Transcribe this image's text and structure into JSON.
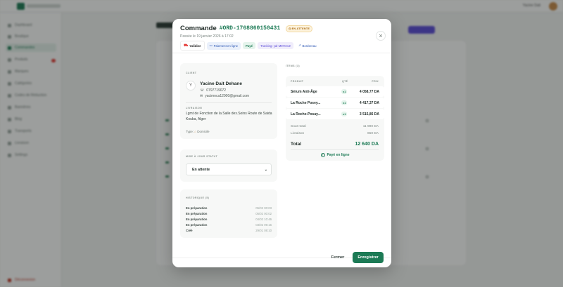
{
  "modal": {
    "title": "Commande",
    "order_number": "#ORD-1768860150431",
    "status_badge": "EN ATTENTE",
    "subtitle": "Passée le 19 janvier 2026 à 17:02",
    "close_symbol": "×"
  },
  "chips": {
    "carrier": "Yalidine",
    "payment": "Paiement en ligne",
    "paid": "Payé",
    "tracking": "Tracking: yal-M97CCZ",
    "bordereau": "Bordereau"
  },
  "client": {
    "section_label": "CLIENT",
    "initial": "Y",
    "name": "Yacine Dait Dehane",
    "phone": "0797719072",
    "email": "yacimnca12000@gmail.com",
    "address_label": "LIVRAISON",
    "address": "Lgmt de Fonction de la Salle dex.Soins Route de Saida",
    "city": "Kouba, Alger",
    "type_label": "Type:",
    "type_value": "Domicile"
  },
  "status": {
    "section_label": "MISE À JOUR STATUT",
    "selected": "En attente"
  },
  "history": {
    "section_label": "HISTORIQUE (5)",
    "rows": [
      {
        "status": "En préparation",
        "date": "05/02 00:03"
      },
      {
        "status": "En préparation",
        "date": "05/02 00:02"
      },
      {
        "status": "En préparation",
        "date": "04/02 10:46"
      },
      {
        "status": "En préparation",
        "date": "03/02 09:16"
      },
      {
        "status": "Créé",
        "date": "29/01 08:10"
      }
    ]
  },
  "items": {
    "section_label": "ITEMS (3)",
    "headers": {
      "product": "PRODUIT",
      "qty": "QTÉ",
      "price": "PRIX"
    },
    "rows": [
      {
        "name": "Sérum Anti-Âge",
        "qty": "x1",
        "price": "4 058,77 DA"
      },
      {
        "name": "La Roche Posey...",
        "qty": "x1",
        "price": "4 417,37 DA"
      },
      {
        "name": "La Roche-Posay...",
        "qty": "x1",
        "price": "3 515,86 DA"
      }
    ],
    "subtotal_label": "Sous-total",
    "subtotal_value": "11 990 DA",
    "shipping_label": "Livraison",
    "shipping_value": "650 DA",
    "total_label": "Total",
    "total_value": "12 640 DA",
    "paid_online": "Payé en ligne"
  },
  "footer": {
    "close_label": "Fermer",
    "save_label": "Enregistrer"
  },
  "background": {
    "user_name": "Yacine Dait",
    "sidebar": [
      "Dashboard",
      "Boutique",
      "Commandes",
      "Produits",
      "Marques",
      "Catégories",
      "Codes de Réduction",
      "Bannières",
      "Blog",
      "Transports",
      "Livraison",
      "Settings"
    ],
    "logout": "Déconnexion"
  },
  "colors": {
    "accent": "#1c7a55",
    "warning": "#a9670c",
    "overlay": "#141816"
  }
}
